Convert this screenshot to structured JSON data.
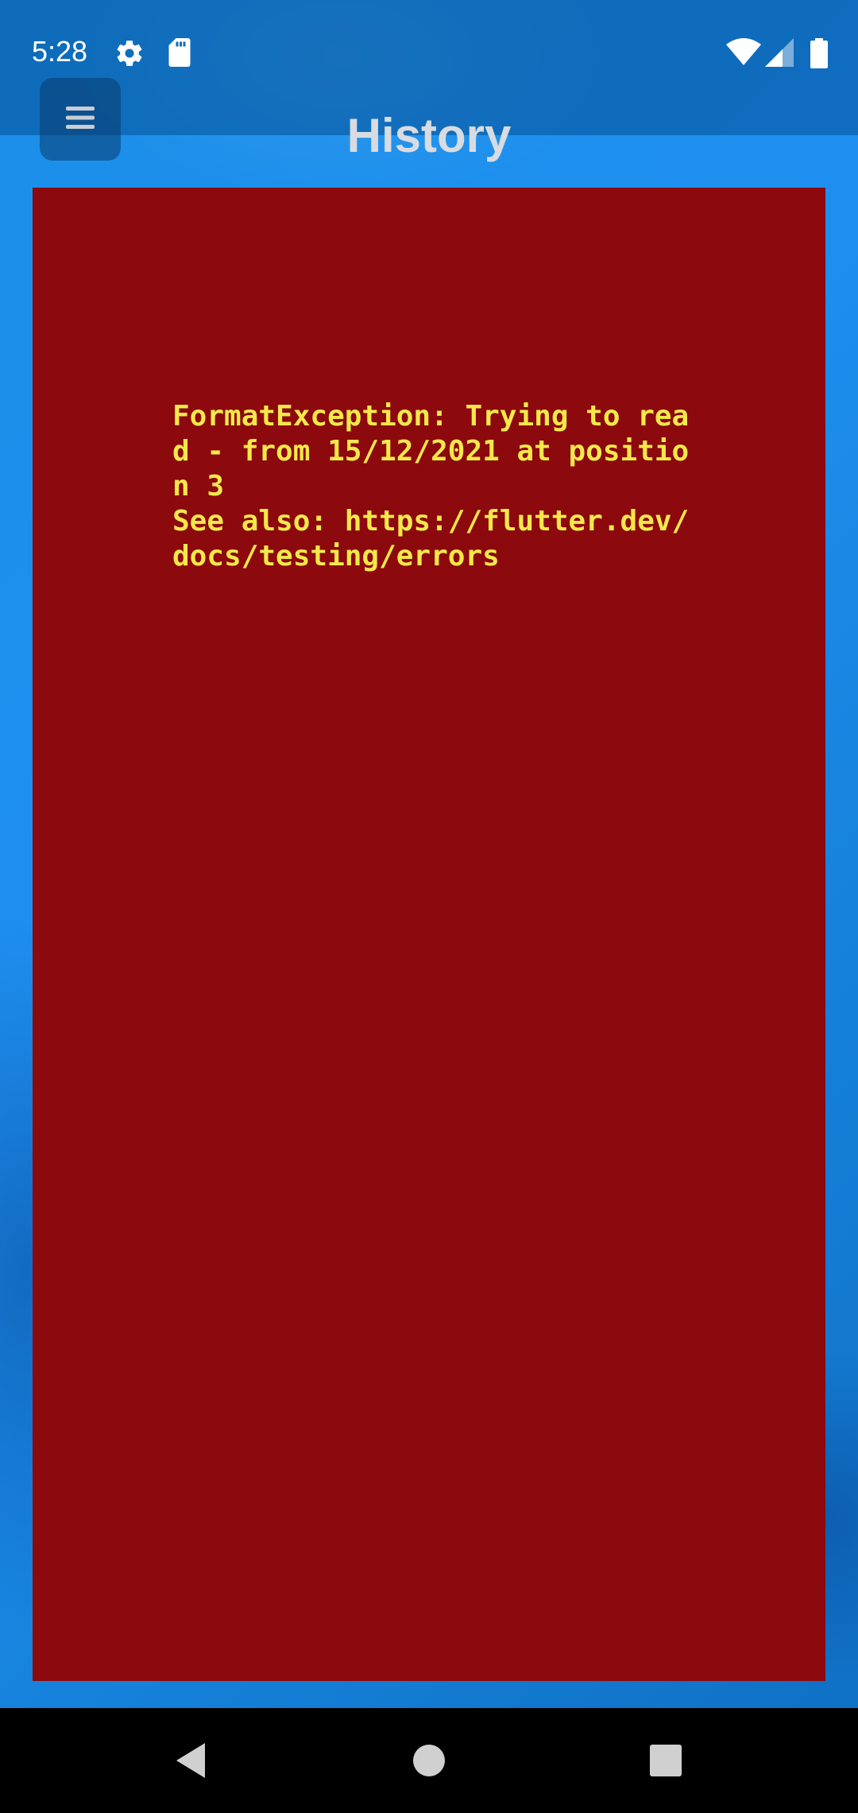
{
  "status_bar": {
    "time": "5:28",
    "icons": [
      "gear-icon",
      "sdcard-icon",
      "wifi-icon",
      "signal-icon",
      "battery-icon"
    ]
  },
  "app_bar": {
    "title": "History",
    "menu_icon": "hamburger-menu-icon"
  },
  "error": {
    "message": "FormatException: Trying to read - from 15/12/2021 at position 3\nSee also: https://flutter.dev/docs/testing/errors",
    "background_color": "#8c090e",
    "text_color": "#f4e84a"
  },
  "nav_bar": {
    "buttons": [
      "back-icon",
      "home-icon",
      "recents-icon"
    ]
  },
  "colors": {
    "accent": "#1e8ff0"
  }
}
